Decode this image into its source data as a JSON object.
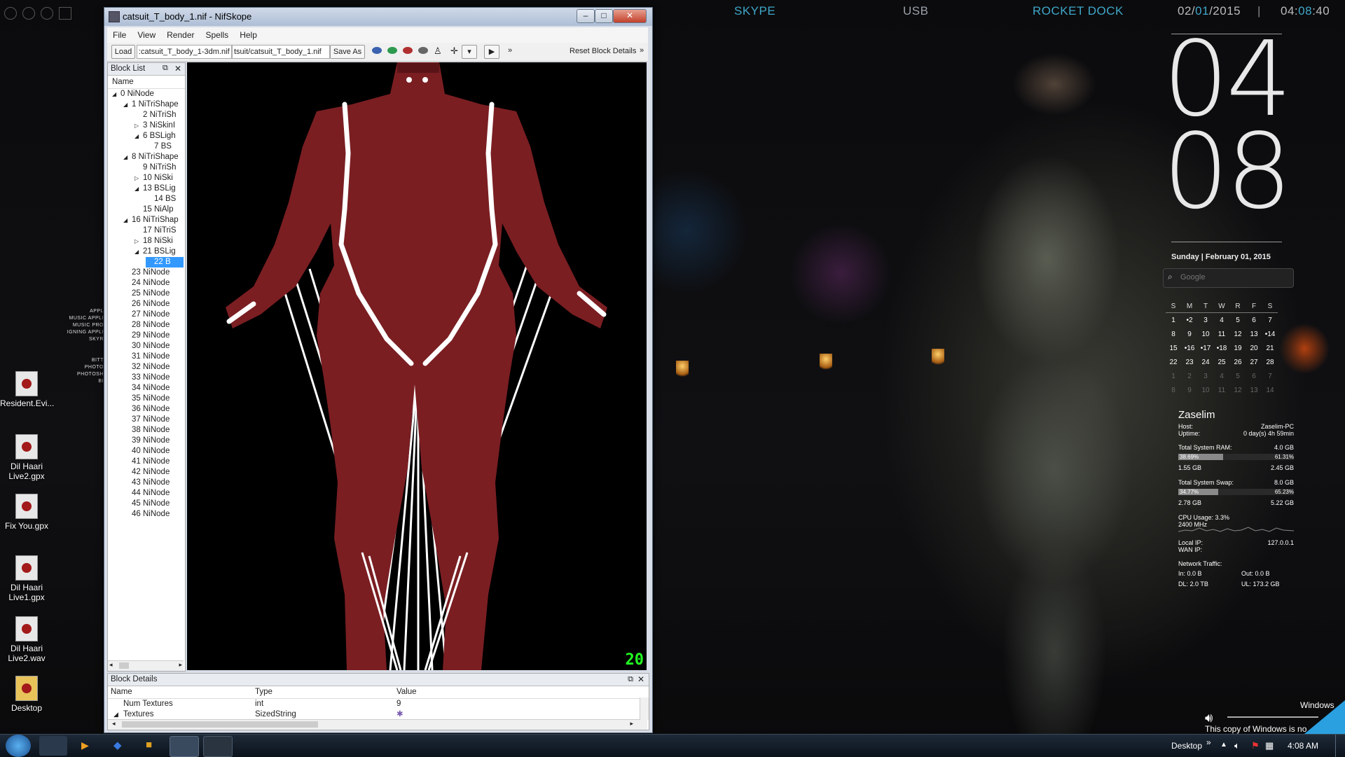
{
  "topbar": {
    "skype": "SKYPE",
    "usb": "USB",
    "rocketdock": "ROCKET DOCK",
    "date_a": "02/",
    "date_b": "01",
    "date_c": "/2015",
    "sep": "|",
    "time_a": "04:",
    "time_b": "08",
    "time_c": ":40",
    "accent_color": "#3fa7c9"
  },
  "desktop_icons": [
    {
      "label": "Resident.Evi...",
      "icon": "archive-icon"
    },
    {
      "label": "Dil Haari Live2.gpx",
      "icon": "guitar-pro-file-icon"
    },
    {
      "label": "Fix You.gpx",
      "icon": "guitar-pro-file-icon"
    },
    {
      "label": "Dil Haari Live1.gpx",
      "icon": "guitar-pro-file-icon"
    },
    {
      "label": "Dil Haari Live2.wav",
      "icon": "wav-file-icon"
    },
    {
      "label": "Desktop",
      "icon": "folder-icon"
    }
  ],
  "side_labels": [
    "APPL",
    "MUSIC APPLI",
    "MUSIC PRO",
    "IGNING APPLI",
    "SKYR",
    "BITT",
    "PHOTO",
    "PHOTOSH",
    "BI"
  ],
  "window": {
    "title": "catsuit_T_body_1.nif - NifSkope",
    "menu": [
      "File",
      "View",
      "Render",
      "Spells",
      "Help"
    ],
    "toolbar": {
      "load": "Load",
      "path_left": ":catsuit_T_body_1-3dm.nif",
      "path_right": "tsuit/catsuit_T_body_1.nif",
      "save_as": "Save As",
      "more": "»",
      "reset": "Reset Block Details"
    },
    "blocklist": {
      "title": "Block List",
      "column": "Name",
      "rows": [
        {
          "text": "0 NiNode",
          "indent": 0,
          "arrow": "◢"
        },
        {
          "text": "1 NiTriShape",
          "indent": 1,
          "arrow": "◢"
        },
        {
          "text": "2 NiTriSh",
          "indent": 2,
          "arrow": ""
        },
        {
          "text": "3 NiSkinI",
          "indent": 2,
          "arrow": "▷"
        },
        {
          "text": "6 BSLigh",
          "indent": 2,
          "arrow": "◢"
        },
        {
          "text": "7 BS",
          "indent": 3,
          "arrow": ""
        },
        {
          "text": "8 NiTriShape",
          "indent": 1,
          "arrow": "◢"
        },
        {
          "text": "9 NiTriSh",
          "indent": 2,
          "arrow": ""
        },
        {
          "text": "10 NiSki",
          "indent": 2,
          "arrow": "▷"
        },
        {
          "text": "13 BSLig",
          "indent": 2,
          "arrow": "◢"
        },
        {
          "text": "14 BS",
          "indent": 3,
          "arrow": ""
        },
        {
          "text": "15 NiAlp",
          "indent": 2,
          "arrow": ""
        },
        {
          "text": "16 NiTriShap",
          "indent": 1,
          "arrow": "◢"
        },
        {
          "text": "17 NiTriS",
          "indent": 2,
          "arrow": ""
        },
        {
          "text": "18 NiSki",
          "indent": 2,
          "arrow": "▷"
        },
        {
          "text": "21 BSLig",
          "indent": 2,
          "arrow": "◢"
        },
        {
          "text": "22 B",
          "indent": 3,
          "arrow": "",
          "selected": true
        },
        {
          "text": "23 NiNode",
          "indent": 1,
          "arrow": ""
        },
        {
          "text": "24 NiNode",
          "indent": 1,
          "arrow": ""
        },
        {
          "text": "25 NiNode",
          "indent": 1,
          "arrow": ""
        },
        {
          "text": "26 NiNode",
          "indent": 1,
          "arrow": ""
        },
        {
          "text": "27 NiNode",
          "indent": 1,
          "arrow": ""
        },
        {
          "text": "28 NiNode",
          "indent": 1,
          "arrow": ""
        },
        {
          "text": "29 NiNode",
          "indent": 1,
          "arrow": ""
        },
        {
          "text": "30 NiNode",
          "indent": 1,
          "arrow": ""
        },
        {
          "text": "31 NiNode",
          "indent": 1,
          "arrow": ""
        },
        {
          "text": "32 NiNode",
          "indent": 1,
          "arrow": ""
        },
        {
          "text": "33 NiNode",
          "indent": 1,
          "arrow": ""
        },
        {
          "text": "34 NiNode",
          "indent": 1,
          "arrow": ""
        },
        {
          "text": "35 NiNode",
          "indent": 1,
          "arrow": ""
        },
        {
          "text": "36 NiNode",
          "indent": 1,
          "arrow": ""
        },
        {
          "text": "37 NiNode",
          "indent": 1,
          "arrow": ""
        },
        {
          "text": "38 NiNode",
          "indent": 1,
          "arrow": ""
        },
        {
          "text": "39 NiNode",
          "indent": 1,
          "arrow": ""
        },
        {
          "text": "40 NiNode",
          "indent": 1,
          "arrow": ""
        },
        {
          "text": "41 NiNode",
          "indent": 1,
          "arrow": ""
        },
        {
          "text": "42 NiNode",
          "indent": 1,
          "arrow": ""
        },
        {
          "text": "43 NiNode",
          "indent": 1,
          "arrow": ""
        },
        {
          "text": "44 NiNode",
          "indent": 1,
          "arrow": ""
        },
        {
          "text": "45 NiNode",
          "indent": 1,
          "arrow": ""
        },
        {
          "text": "46 NiNode",
          "indent": 1,
          "arrow": ""
        }
      ]
    },
    "fps": "20",
    "details": {
      "title": "Block Details",
      "columns": [
        "Name",
        "Type",
        "Value"
      ],
      "rows": [
        {
          "name": "Num Textures",
          "type": "int",
          "value": "9"
        },
        {
          "name": "Textures",
          "type": "SizedString",
          "value": ""
        }
      ]
    },
    "model_color": "#7a1e22"
  },
  "clock": {
    "hour": "04",
    "minute": "08"
  },
  "date_line": "Sunday | February 01, 2015",
  "search_placeholder": "Google",
  "calendar": {
    "days": [
      "S",
      "M",
      "T",
      "W",
      "R",
      "F",
      "S"
    ],
    "weeks": [
      [
        "1",
        "•2",
        "3",
        "4",
        "5",
        "6",
        "7"
      ],
      [
        "8",
        "9",
        "10",
        "11",
        "12",
        "13",
        "•14"
      ],
      [
        "15",
        "•16",
        "•17",
        "•18",
        "19",
        "20",
        "21"
      ],
      [
        "22",
        "23",
        "24",
        "25",
        "26",
        "27",
        "28"
      ],
      [
        "1",
        "2",
        "3",
        "4",
        "5",
        "6",
        "7"
      ],
      [
        "8",
        "9",
        "10",
        "11",
        "12",
        "13",
        "14"
      ]
    ]
  },
  "sysinfo": {
    "user": "Zaselim",
    "host_label": "Host:",
    "host": "Zaselim-PC",
    "uptime_label": "Uptime:",
    "uptime": "0 day(s) 4h 59min",
    "ram_label": "Total System RAM:",
    "ram_total": "4.0 GB",
    "ram_used_pct": "38.69%",
    "ram_free_pct": "61.31%",
    "ram_used": "1.55 GB",
    "ram_free": "2.45 GB",
    "ram_fill": 0.3869,
    "swap_label": "Total System Swap:",
    "swap_total": "8.0 GB",
    "swap_used_pct": "34.77%",
    "swap_free_pct": "65.23%",
    "swap_used": "2.78 GB",
    "swap_free": "5.22 GB",
    "swap_fill": 0.3477,
    "cpu_label": "CPU Usage: 3.3%",
    "cpu_mhz": "2400 MHz",
    "localip_label": "Local IP:",
    "localip": "127.0.0.1",
    "wanip_label": "WAN IP:",
    "net_label": "Network Traffic:",
    "in": "In: 0.0 B",
    "out": "Out: 0.0 B",
    "dl": "DL: 2.0 TB",
    "ul": "UL: 173.2 GB"
  },
  "notice": {
    "line1": "Windows",
    "line2": "This copy of Windows is no"
  },
  "taskbar": {
    "desktop": "Desktop",
    "chev": "»",
    "time": "4:08 AM"
  }
}
